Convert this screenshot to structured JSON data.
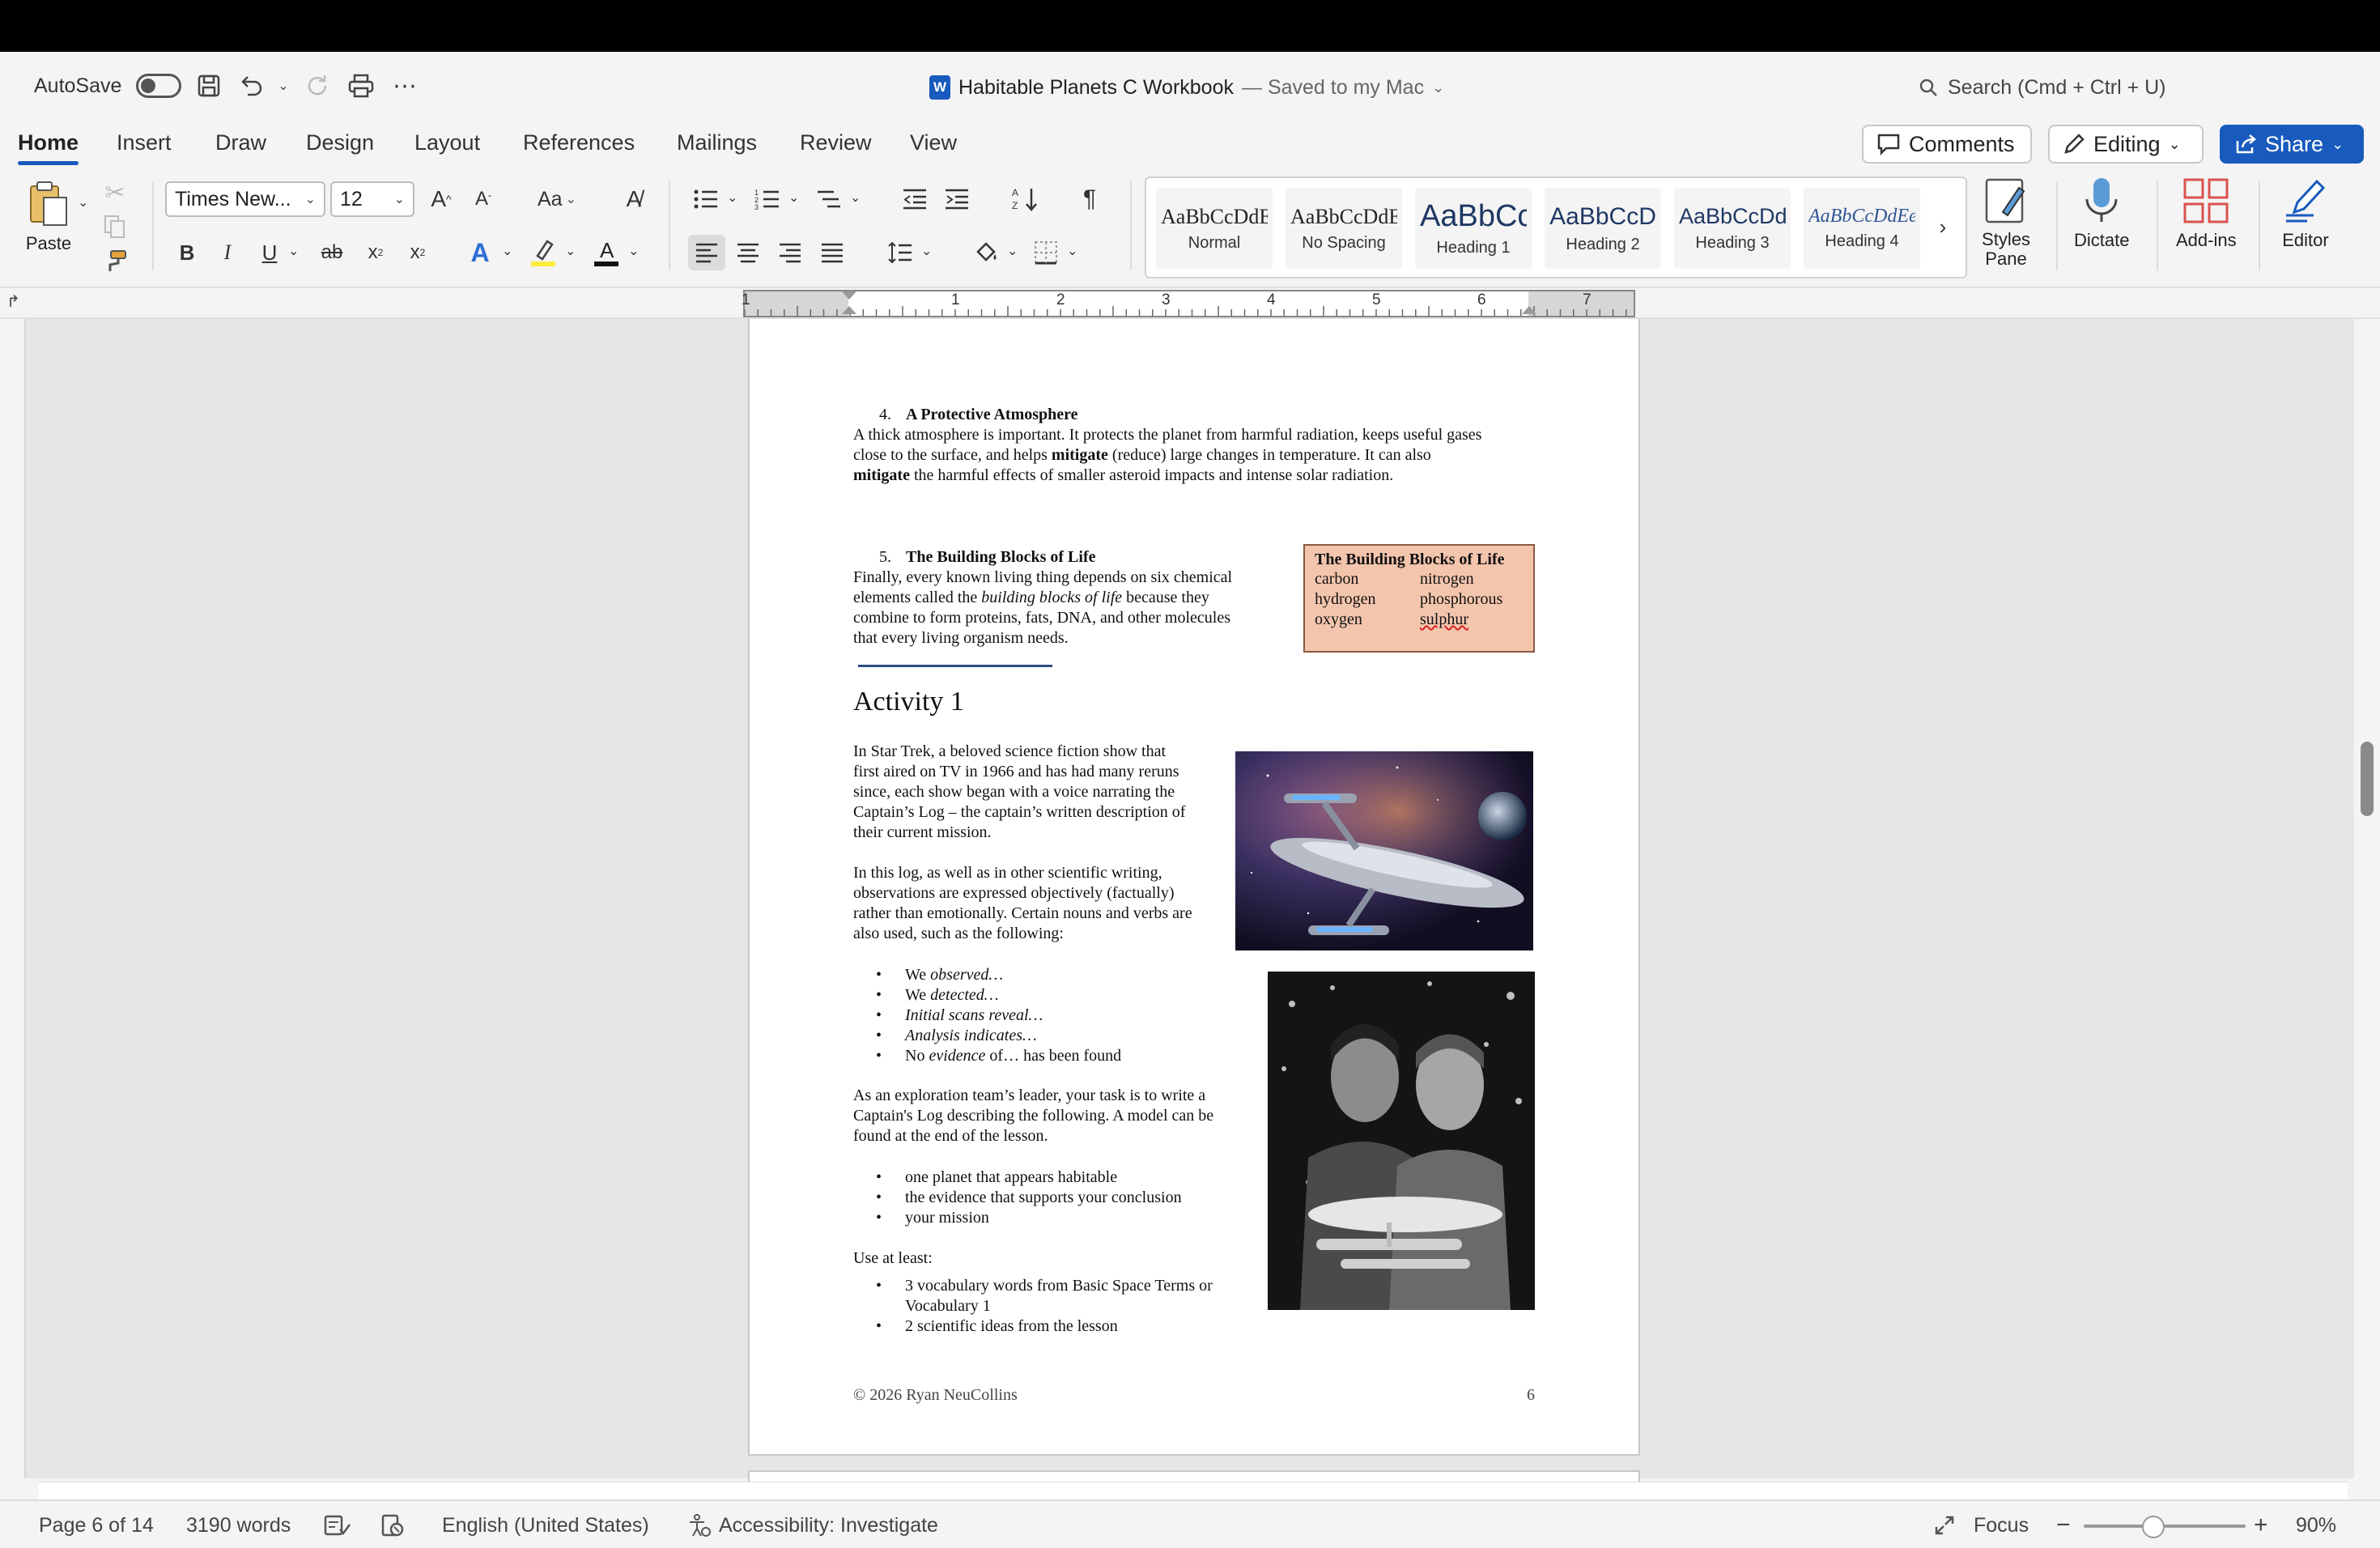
{
  "titlebar": {
    "autosave_label": "AutoSave",
    "doc_title": "Habitable Planets C Workbook",
    "saved_status": "— Saved to my Mac",
    "search_placeholder": "Search (Cmd + Ctrl + U)"
  },
  "tabs": [
    "Home",
    "Insert",
    "Draw",
    "Design",
    "Layout",
    "References",
    "Mailings",
    "Review",
    "View"
  ],
  "top_buttons": {
    "comments": "Comments",
    "editing": "Editing",
    "share": "Share"
  },
  "ribbon": {
    "paste_label": "Paste",
    "font_name": "Times New...",
    "font_size": "12",
    "case_label": "Aa",
    "styles": [
      {
        "preview": "AaBbCcDdE",
        "name": "Normal"
      },
      {
        "preview": "AaBbCcDdE",
        "name": "No Spacing"
      },
      {
        "preview": "AaBbCc",
        "name": "Heading 1"
      },
      {
        "preview": "AaBbCcD",
        "name": "Heading 2"
      },
      {
        "preview": "AaBbCcDd",
        "name": "Heading 3"
      },
      {
        "preview": "AaBbCcDdEe",
        "name": "Heading 4"
      }
    ],
    "styles_pane": "Styles\nPane",
    "dictate": "Dictate",
    "addins": "Add-ins",
    "editor": "Editor"
  },
  "ruler_numbers": [
    "1",
    "1",
    "2",
    "3",
    "4",
    "5",
    "6",
    "7"
  ],
  "document": {
    "item4_num": "4.",
    "item4_title": "A Protective Atmosphere",
    "item4_l1": "A thick atmosphere is important. It protects the planet from harmful radiation, keeps useful gases",
    "item4_l2a": "close to the surface, and helps ",
    "item4_l2b": "mitigate",
    "item4_l2c": " (reduce) large changes in temperature. It can also",
    "item4_l3a": "mitigate",
    "item4_l3b": " the harmful effects of smaller asteroid impacts and intense solar radiation.",
    "item5_num": "5.",
    "item5_title": "The Building Blocks of Life",
    "item5_l1": "Finally, every known living thing depends on six chemical",
    "item5_l2a": "elements called the ",
    "item5_l2b": "building blocks of life",
    "item5_l2c": " because they",
    "item5_l3": "combine to form proteins, fats, DNA, and other molecules",
    "item5_l4": "that every living organism needs.",
    "box_title": "The Building Blocks of Life",
    "box_elements": [
      "carbon",
      "nitrogen",
      "hydrogen",
      "phosphorous",
      "oxygen",
      "sulphur"
    ],
    "activity_heading": "Activity 1",
    "p1": [
      "In Star Trek, a beloved science fiction show that",
      "first aired on TV in 1966 and has had many reruns",
      "since, each show began with a voice narrating the",
      "Captain’s Log – the captain’s written description of",
      "their current mission."
    ],
    "p2": [
      "In this log, as well as in other scientific writing,",
      "observations are expressed objectively (factually)",
      "rather than emotionally. Certain nouns and verbs are",
      "also used, such as the following:"
    ],
    "bullets1": [
      {
        "a": "We ",
        "i": "observed…",
        "b": ""
      },
      {
        "a": "We ",
        "i": "detected…",
        "b": ""
      },
      {
        "a": "",
        "i": "Initial scans reveal…",
        "b": ""
      },
      {
        "a": "",
        "i": "Analysis indicates…",
        "b": ""
      },
      {
        "a": "No ",
        "i": "evidence",
        "b": " of… has been found"
      }
    ],
    "p3": [
      "As an exploration team’s leader, your task is to write a",
      "Captain's Log describing the following. A model can be",
      "found at the end of the lesson."
    ],
    "bullets2": [
      "one planet that appears habitable",
      "the evidence that supports your conclusion",
      "your mission"
    ],
    "use_at_least": "Use at least:",
    "bullets3_1a": "3 vocabulary words from Basic Space Terms or",
    "bullets3_1b": "Vocabulary 1",
    "bullets3_2": "2 scientific ideas from the lesson",
    "footer_left": "© 2026 Ryan NeuCollins",
    "footer_right": "6"
  },
  "statusbar": {
    "page": "Page 6 of 14",
    "words": "3190 words",
    "language": "English (United States)",
    "accessibility": "Accessibility: Investigate",
    "focus": "Focus",
    "zoom": "90%"
  },
  "colors": {
    "accent": "#185abd",
    "box_fill": "#f4c5ad",
    "rule_line": "#2c4e82"
  }
}
